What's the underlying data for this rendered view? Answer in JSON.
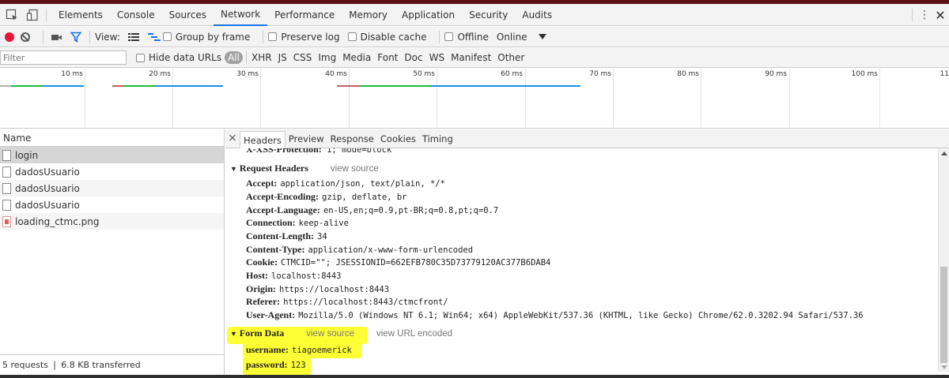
{
  "tabbar": {
    "tabs": [
      "Elements",
      "Console",
      "Sources",
      "Network",
      "Performance",
      "Memory",
      "Application",
      "Security",
      "Audits"
    ],
    "active_tab": "Network"
  },
  "toolbar": {
    "view_label": "View:",
    "group_by_frame": "Group by frame",
    "preserve_log": "Preserve log",
    "disable_cache": "Disable cache",
    "offline": "Offline",
    "throttle": "Online"
  },
  "filterbar": {
    "placeholder": "Filter",
    "hide_data_urls": "Hide data URLs",
    "types": [
      "All",
      "XHR",
      "JS",
      "CSS",
      "Img",
      "Media",
      "Font",
      "Doc",
      "WS",
      "Manifest",
      "Other"
    ]
  },
  "overview": {
    "ticks": [
      "10 ms",
      "20 ms",
      "30 ms",
      "40 ms",
      "50 ms",
      "60 ms",
      "70 ms",
      "80 ms",
      "90 ms",
      "100 ms",
      "11"
    ]
  },
  "requests": {
    "column_name": "Name",
    "items": [
      {
        "name": "login",
        "type": "doc"
      },
      {
        "name": "dadosUsuario",
        "type": "doc"
      },
      {
        "name": "dadosUsuario",
        "type": "doc"
      },
      {
        "name": "dadosUsuario",
        "type": "doc"
      },
      {
        "name": "loading_ctmc.png",
        "type": "img"
      }
    ],
    "summary": "5 requests ❘ 6.8 KB transferred"
  },
  "details": {
    "close": "×",
    "tabs": [
      "Headers",
      "Preview",
      "Response",
      "Cookies",
      "Timing"
    ],
    "active_tab": "Headers",
    "cut_header": {
      "name": "X-XSS-Protection:",
      "value": "1; mode=block"
    },
    "request_headers": {
      "title": "Request Headers",
      "view_source": "view source",
      "items": [
        {
          "name": "Accept:",
          "value": "application/json, text/plain, */*"
        },
        {
          "name": "Accept-Encoding:",
          "value": "gzip, deflate, br"
        },
        {
          "name": "Accept-Language:",
          "value": "en-US,en;q=0.9,pt-BR;q=0.8,pt;q=0.7"
        },
        {
          "name": "Connection:",
          "value": "keep-alive"
        },
        {
          "name": "Content-Length:",
          "value": "34"
        },
        {
          "name": "Content-Type:",
          "value": "application/x-www-form-urlencoded"
        },
        {
          "name": "Cookie:",
          "value": "CTMCID=\"\"; JSESSIONID=662EFB780C35D73779120AC377B6DAB4"
        },
        {
          "name": "Host:",
          "value": "localhost:8443"
        },
        {
          "name": "Origin:",
          "value": "https://localhost:8443"
        },
        {
          "name": "Referer:",
          "value": "https://localhost:8443/ctmcfront/"
        },
        {
          "name": "User-Agent:",
          "value": "Mozilla/5.0 (Windows NT 6.1; Win64; x64) AppleWebKit/537.36 (KHTML, like Gecko) Chrome/62.0.3202.94 Safari/537.36"
        }
      ]
    },
    "form_data": {
      "title": "Form Data",
      "view_source": "view source",
      "view_url_encoded": "view URL encoded",
      "items": [
        {
          "name": "username:",
          "value": "tiagoemerick"
        },
        {
          "name": "password:",
          "value": "123"
        }
      ]
    }
  },
  "colors": {
    "highlight": "#ffff35",
    "record": "#e8153a",
    "active_tab_underline": "#1a73e8"
  }
}
